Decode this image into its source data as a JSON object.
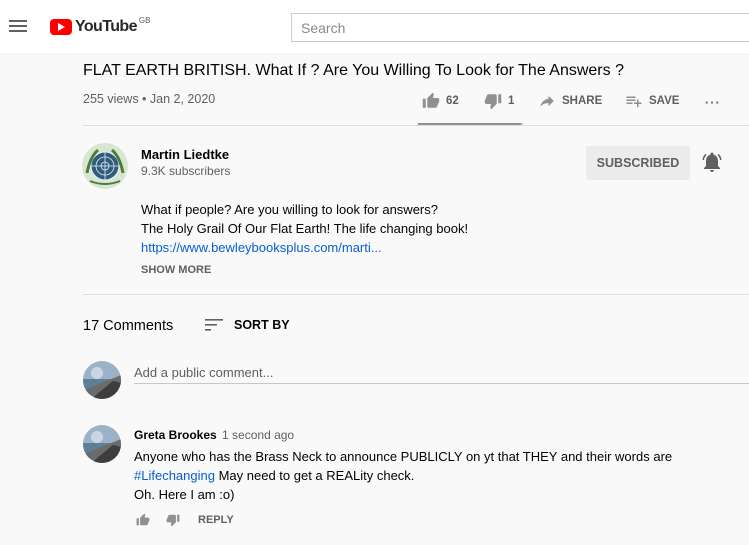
{
  "header": {
    "logo_text": "YouTube",
    "region": "GB",
    "search_placeholder": "Search"
  },
  "video": {
    "title": "FLAT EARTH BRITISH. What If ? Are You Willing To Look for The Answers ?",
    "meta": "255 views • Jan 2, 2020",
    "likes": "62",
    "dislikes": "1",
    "share_label": "SHARE",
    "save_label": "SAVE",
    "like_fraction": 0.98
  },
  "channel": {
    "name": "Martin Liedtke",
    "subscribers": "9.3K subscribers",
    "subscribed_label": "SUBSCRIBED"
  },
  "description": {
    "line1": "What if people? Are you willing to look for answers?",
    "line2": "The Holy Grail Of Our Flat Earth! The life changing book!",
    "link": "https://www.bewleybooksplus.com/marti...",
    "show_more": "SHOW MORE"
  },
  "comments": {
    "count": "17 Comments",
    "sort_label": "SORT BY",
    "add_placeholder": "Add a public comment...",
    "items": [
      {
        "author": "Greta Brookes",
        "time": "1 second ago",
        "text_part1": "Anyone who has the Brass Neck to announce PUBLICLY on yt that THEY and their words are",
        "hashtag": "#Lifechanging",
        "text_part2": " May need to get a REALity check.",
        "line3": "Oh. Here I am :o)",
        "reply_label": "REPLY"
      }
    ]
  },
  "colors": {
    "brand_red": "#ff0000",
    "link_blue": "#065fd4",
    "muted_text": "#606060"
  }
}
